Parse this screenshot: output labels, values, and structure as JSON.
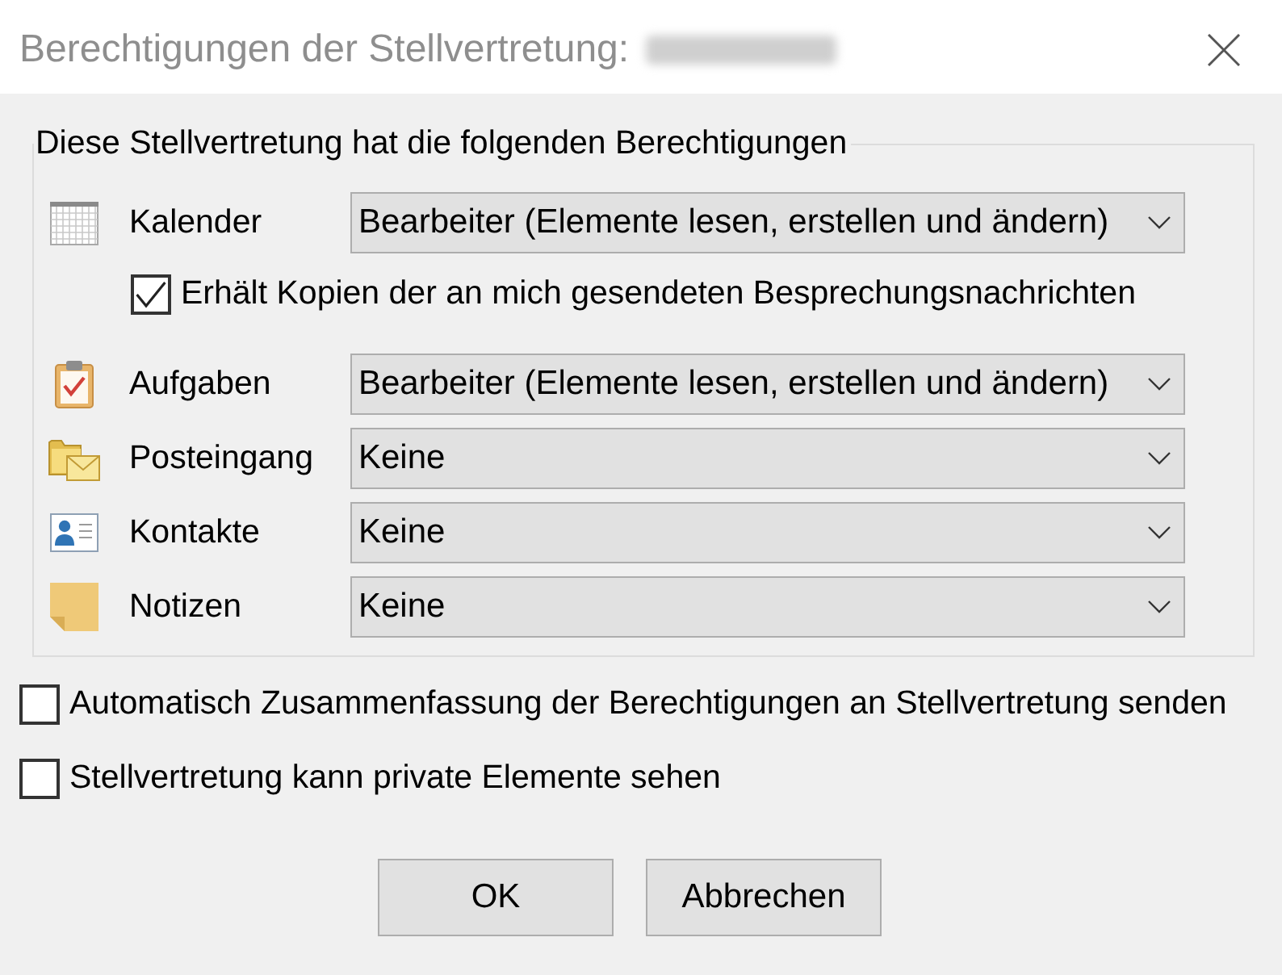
{
  "window": {
    "title": "Berechtigungen der Stellvertretung:",
    "name_blurred": true
  },
  "group": {
    "legend": "Diese Stellvertretung hat die folgenden Berechtigungen",
    "folders": [
      {
        "kind": "calendar",
        "label": "Kalender",
        "permission": "Bearbeiter (Elemente lesen, erstellen und ändern)",
        "option": {
          "label": "Erhält Kopien der an mich gesendeten Besprechungsnachrichten",
          "checked": true
        }
      },
      {
        "kind": "tasks",
        "label": "Aufgaben",
        "permission": "Bearbeiter (Elemente lesen, erstellen und ändern)"
      },
      {
        "kind": "inbox",
        "label": "Posteingang",
        "permission": "Keine"
      },
      {
        "kind": "contacts",
        "label": "Kontakte",
        "permission": "Keine"
      },
      {
        "kind": "notes",
        "label": "Notizen",
        "permission": "Keine"
      }
    ]
  },
  "options": [
    {
      "label": "Automatisch Zusammenfassung der Berechtigungen an Stellvertretung senden",
      "checked": false
    },
    {
      "label": "Stellvertretung kann private Elemente sehen",
      "checked": false
    }
  ],
  "buttons": [
    "OK",
    "Abbrechen"
  ]
}
